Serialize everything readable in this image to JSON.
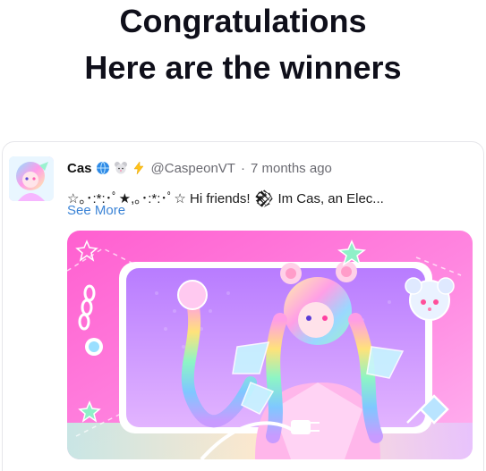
{
  "headline": {
    "line1": "Congratulations",
    "line2": "Here are the winners"
  },
  "post": {
    "author_name": "Cas",
    "badges": [
      "globe-icon",
      "mouse-face-icon",
      "lightning-icon"
    ],
    "handle": "@CaspeonVT",
    "separator": "·",
    "time_ago": "7 months ago",
    "bio": "☆｡･:*:･ﾟ★,｡･:*:･ﾟ☆ Hi friends! 𒆙 Im Cas, an Elec...",
    "see_more": "See More"
  },
  "colors": {
    "link": "#3c84d6",
    "meta": "#6b6b72",
    "banner_pink": "#ff6ad5",
    "banner_purple": "#c77dff"
  }
}
